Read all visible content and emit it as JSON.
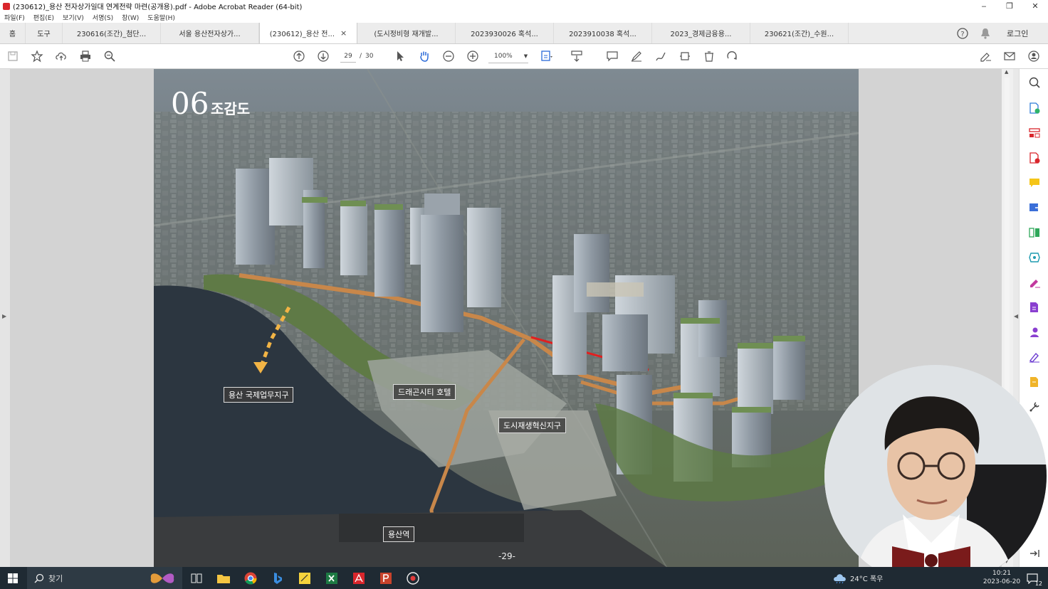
{
  "window": {
    "title": "(230612)_용산 전자상가일대 연계전략 마련(공개용).pdf - Adobe Acrobat Reader (64-bit)",
    "min": "‒",
    "max": "❐",
    "close": "✕"
  },
  "menu": [
    "파일(F)",
    "편집(E)",
    "보기(V)",
    "서명(S)",
    "창(W)",
    "도움말(H)"
  ],
  "tabs": {
    "home": "홈",
    "tools": "도구",
    "docs": [
      "230616(조간)_첨단...",
      "서울 용산전자상가...",
      "(230612)_용산 전...",
      "(도시정비형 재개발...",
      "2023930026 혹석...",
      "2023910038 혹석...",
      "2023_경제금융용...",
      "230621(조간)_수원..."
    ],
    "active_index": 2,
    "close_glyph": "×",
    "login": "로그인"
  },
  "toolbar": {
    "page_current": "29",
    "page_sep": "/",
    "page_total": "30",
    "zoom": "100%"
  },
  "slide": {
    "number": "06",
    "title": "조감도",
    "labels": {
      "yongsan_intl": "용산 국제업무지구",
      "dragon_hotel": "드래곤시티 호텔",
      "urban_regen": "도시재생혁신지구",
      "yongsan_station": "용산역"
    },
    "page_footer": "-29-"
  },
  "taskbar": {
    "search_placeholder": "찾기",
    "weather": "24°C 폭우",
    "time": "10:21",
    "date": "2023-06-20",
    "notif_count": "12"
  },
  "colors": {
    "acrobat_red": "#d9262c",
    "taskbar": "#1f2a33",
    "annotation_red": "#e02020",
    "walkway_orange": "#c8874a"
  }
}
